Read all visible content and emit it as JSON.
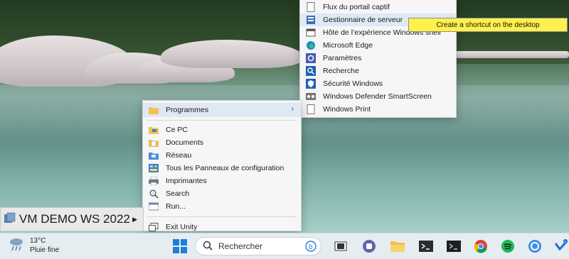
{
  "programs_submenu": {
    "items": [
      {
        "label": "Flux du portail captif",
        "icon": "document-icon"
      },
      {
        "label": "Gestionnaire de serveur",
        "icon": "server-manager-icon",
        "highlighted": true
      },
      {
        "label": "Hôte de l’expérience Windows shell",
        "icon": "window-icon"
      },
      {
        "label": "Microsoft Edge",
        "icon": "edge-icon"
      },
      {
        "label": "Paramètres",
        "icon": "gear-icon"
      },
      {
        "label": "Recherche",
        "icon": "search-icon"
      },
      {
        "label": "Sécurité Windows",
        "icon": "shield-icon"
      },
      {
        "label": "Windows Defender SmartScreen",
        "icon": "smartscreen-icon"
      },
      {
        "label": "Windows Print",
        "icon": "document-icon"
      }
    ]
  },
  "tooltip": {
    "text": "Create a shortcut on the desktop"
  },
  "main_menu": {
    "programs_label": "Programmes",
    "items": [
      {
        "label": "Ce PC",
        "icon": "folder-pc-icon"
      },
      {
        "label": "Documents",
        "icon": "documents-icon"
      },
      {
        "label": "Réseau",
        "icon": "network-icon"
      },
      {
        "label": "Tous les Panneaux de configuration",
        "icon": "control-panel-icon"
      },
      {
        "label": "Imprimantes",
        "icon": "printer-icon"
      },
      {
        "label": "Search",
        "icon": "search-icon"
      },
      {
        "label": "Run...",
        "icon": "run-icon"
      }
    ],
    "exit_label": "Exit Unity"
  },
  "vm": {
    "name": "VM DEMO WS 2022"
  },
  "taskbar": {
    "weather_temp": "13°C",
    "weather_desc": "Pluie fine",
    "search_placeholder": "Rechercher",
    "apps": [
      "windows-start-icon",
      "task-view-icon",
      "teams-icon",
      "file-explorer-icon",
      "terminal-icon",
      "powershell-icon",
      "chrome-icon",
      "spotify-icon",
      "copilot-icon",
      "vmware-icon"
    ]
  },
  "colors": {
    "highlight": "#dfe8f5",
    "tooltip_bg": "#fff04c",
    "taskbar_bg": "#e6edf1",
    "menu_bg": "#f6f6f6"
  }
}
